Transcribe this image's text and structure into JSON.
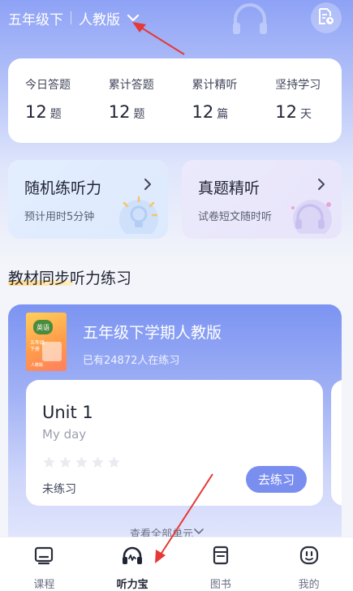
{
  "header": {
    "grade": "五年级下",
    "edition": "人教版",
    "icons": {
      "dropdown": "chevron-down-icon",
      "doc": "document-clock-icon"
    }
  },
  "stats": [
    {
      "label": "今日答题",
      "value": "12",
      "unit": "题"
    },
    {
      "label": "累计答题",
      "value": "12",
      "unit": "题"
    },
    {
      "label": "累计精听",
      "value": "12",
      "unit": "篇"
    },
    {
      "label": "坚持学习",
      "value": "12",
      "unit": "天"
    }
  ],
  "cards": {
    "random": {
      "title": "随机练听力",
      "subtitle": "预计用时5分钟"
    },
    "real": {
      "title": "真题精听",
      "subtitle": "试卷短文随时听"
    }
  },
  "section": {
    "title": "教材同步听力练习"
  },
  "course": {
    "book": {
      "badge": "英语",
      "line1": "五年级",
      "line2": "下册",
      "publisher": "人教版"
    },
    "title": "五年级下学期人教版",
    "subtitle": "已有24872人在练习",
    "unit": {
      "title": "Unit 1",
      "subtitle": "My day",
      "stars": 0,
      "stars_total": 5,
      "status": "未练习",
      "button": "去练习"
    },
    "view_all": "查看全部单元"
  },
  "tabs": [
    {
      "label": "课程",
      "icon": "monitor-icon",
      "active": false
    },
    {
      "label": "听力宝",
      "icon": "headphones-icon",
      "active": true
    },
    {
      "label": "图书",
      "icon": "book-icon",
      "active": false
    },
    {
      "label": "我的",
      "icon": "face-icon",
      "active": false
    }
  ],
  "colors": {
    "accent": "#7a8ef0",
    "hero_top": "#8ea2f6",
    "annotation": "#e53935"
  }
}
